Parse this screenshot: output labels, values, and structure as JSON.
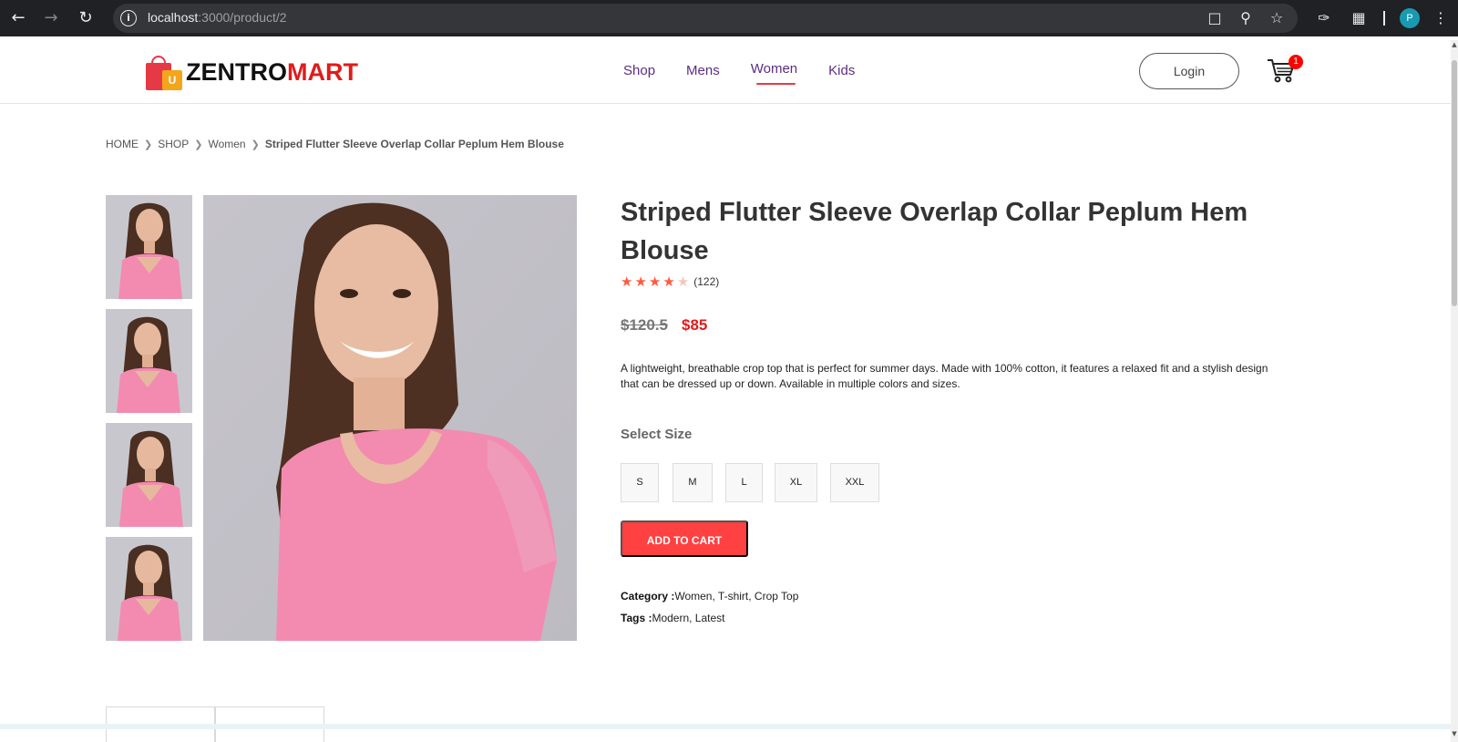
{
  "browser": {
    "url_host": "localhost",
    "url_path": ":3000/product/2",
    "profile_initial": "P"
  },
  "header": {
    "logo_part1": "ZENTRO",
    "logo_part2": "MART",
    "logo_bag_letter": "U",
    "nav": [
      {
        "label": "Shop",
        "active": false
      },
      {
        "label": "Mens",
        "active": false
      },
      {
        "label": "Women",
        "active": true
      },
      {
        "label": "Kids",
        "active": false
      }
    ],
    "login_label": "Login",
    "cart_count": "1"
  },
  "breadcrumb": [
    "HOME",
    "SHOP",
    "Women",
    "Striped Flutter Sleeve Overlap Collar Peplum Hem Blouse"
  ],
  "product": {
    "title": "Striped Flutter Sleeve Overlap Collar Peplum Hem Blouse",
    "rating": 4,
    "rating_max": 5,
    "review_count": "(122)",
    "price_old": "$120.5",
    "price_new": "$85",
    "description": "A lightweight, breathable crop top that is perfect for summer days. Made with 100% cotton, it features a relaxed fit and a stylish design that can be dressed up or down. Available in multiple colors and sizes.",
    "size_label": "Select Size",
    "sizes": [
      "S",
      "M",
      "L",
      "XL",
      "XXL"
    ],
    "add_to_cart_label": "ADD TO CART",
    "category_key": "Category :",
    "category_value": "Women, T-shirt, Crop Top",
    "tags_key": "Tags :",
    "tags_value": "Modern, Latest"
  },
  "colors": {
    "accent_red": "#ff4141",
    "brand_red": "#e01b1b",
    "nav_purple": "#5b2d83",
    "star": "#ff5a3d",
    "shirt_pink": "#f38bb0"
  }
}
